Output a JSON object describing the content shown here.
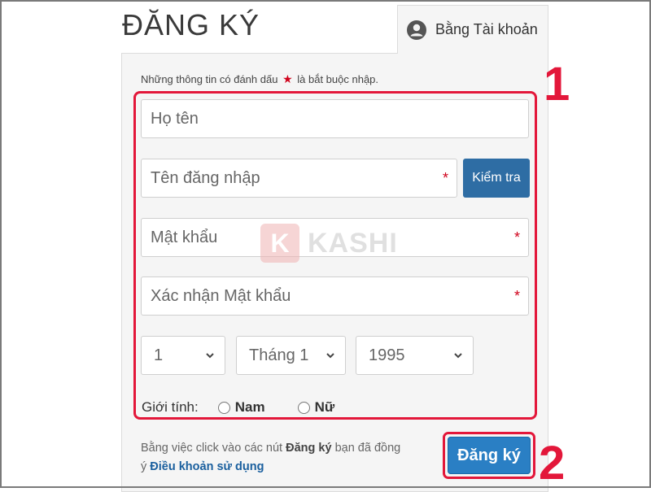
{
  "header": {
    "title": "ĐĂNG KÝ",
    "account_tab": "Bằng Tài khoản",
    "account_icon": "user-circle-icon"
  },
  "form": {
    "required_note_prefix": "Những thông tin có đánh dấu",
    "required_star": "★",
    "required_note_suffix": "là bắt buộc nhập.",
    "fullname_placeholder": "Họ tên",
    "username_placeholder": "Tên đăng nhập",
    "password_placeholder": "Mật khẩu",
    "confirm_placeholder": "Xác nhận Mật khẩu",
    "req_mark": "*",
    "check_button": "Kiểm tra",
    "day": "1",
    "month": "Tháng 1",
    "year": "1995",
    "gender_label": "Giới tính:",
    "gender_male": "Nam",
    "gender_female": "Nữ"
  },
  "footer": {
    "legal_prefix": "Bằng việc click vào các nút",
    "legal_button_ref": "Đăng ký",
    "legal_mid": "bạn đã đồng ý",
    "terms_link": "Điều khoản sử dụng",
    "submit_button": "Đăng ký"
  },
  "annotations": {
    "step1": "1",
    "step2": "2"
  },
  "watermark": {
    "logo_letter": "K",
    "text": "KASHI"
  },
  "colors": {
    "primary": "#2e6da4",
    "highlight": "#e3173a",
    "required": "#d0021b"
  }
}
